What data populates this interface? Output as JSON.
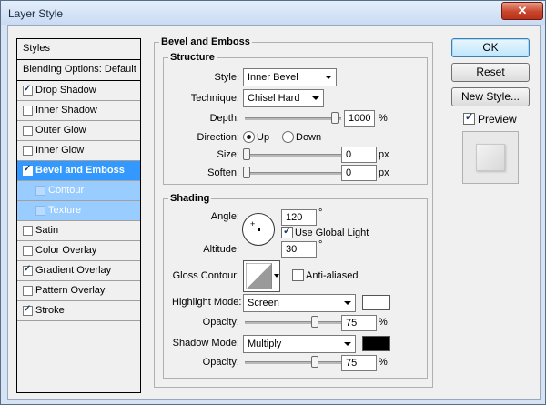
{
  "window": {
    "title": "Layer Style",
    "close_glyph": "✕"
  },
  "styles_list": {
    "header": "Styles",
    "blending": "Blending Options: Default",
    "items": [
      {
        "label": "Drop Shadow",
        "checked": true
      },
      {
        "label": "Inner Shadow",
        "checked": false
      },
      {
        "label": "Outer Glow",
        "checked": false
      },
      {
        "label": "Inner Glow",
        "checked": false
      },
      {
        "label": "Bevel and Emboss",
        "checked": true,
        "selected": true
      },
      {
        "label": "Contour",
        "checked": false,
        "sub": true
      },
      {
        "label": "Texture",
        "checked": false,
        "sub": true
      },
      {
        "label": "Satin",
        "checked": false
      },
      {
        "label": "Color Overlay",
        "checked": false
      },
      {
        "label": "Gradient Overlay",
        "checked": true
      },
      {
        "label": "Pattern Overlay",
        "checked": false
      },
      {
        "label": "Stroke",
        "checked": true
      }
    ]
  },
  "bevel": {
    "group_title": "Bevel and Emboss",
    "structure": {
      "title": "Structure",
      "style_label": "Style:",
      "style_value": "Inner Bevel",
      "technique_label": "Technique:",
      "technique_value": "Chisel Hard",
      "depth_label": "Depth:",
      "depth_value": "1000",
      "depth_unit": "%",
      "direction_label": "Direction:",
      "dir_up": "Up",
      "dir_down": "Down",
      "size_label": "Size:",
      "size_value": "0",
      "size_unit": "px",
      "soften_label": "Soften:",
      "soften_value": "0",
      "soften_unit": "px"
    },
    "shading": {
      "title": "Shading",
      "angle_label": "Angle:",
      "angle_value": "120",
      "degree": "°",
      "global_light_label": "Use Global Light",
      "global_light_checked": true,
      "altitude_label": "Altitude:",
      "altitude_value": "30",
      "gloss_label": "Gloss Contour:",
      "anti_aliased_label": "Anti-aliased",
      "highlight_mode_label": "Highlight Mode:",
      "highlight_mode_value": "Screen",
      "highlight_color": "#ffffff",
      "hl_opacity_label": "Opacity:",
      "hl_opacity_value": "75",
      "shadow_mode_label": "Shadow Mode:",
      "shadow_mode_value": "Multiply",
      "shadow_color": "#000000",
      "sh_opacity_label": "Opacity:",
      "sh_opacity_value": "75",
      "pct": "%"
    }
  },
  "buttons": {
    "ok": "OK",
    "reset": "Reset",
    "new_style": "New Style...",
    "preview": "Preview",
    "preview_checked": true
  }
}
